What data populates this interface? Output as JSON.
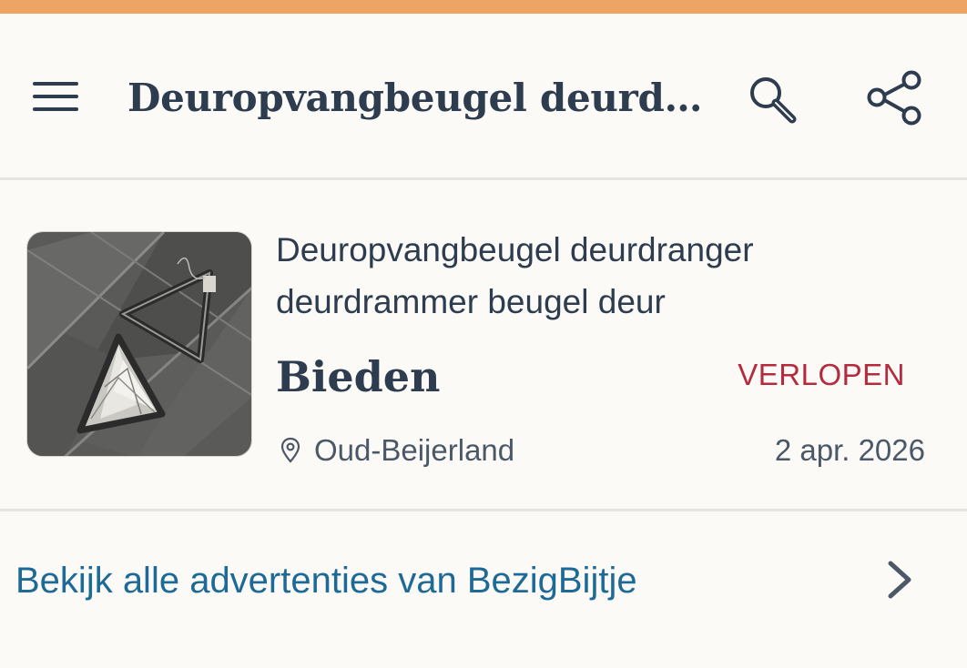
{
  "colors": {
    "accent_bar": "#eda464",
    "text_primary": "#2d3c4f",
    "status_expired": "#b52a3d",
    "link": "#1e6a97",
    "background": "#fcfaf6"
  },
  "header": {
    "menu_icon": "hamburger-menu-icon",
    "title": "Deuropvangbeugel deurdranger deurdrammer beugel deur",
    "search_icon": "search-icon",
    "share_icon": "share-icon"
  },
  "listing": {
    "title": "Deuropvangbeugel deurdranger deurdrammer beugel deur",
    "price": "Bieden",
    "status": "VERLOPEN",
    "location_icon": "location-pin-icon",
    "location": "Oud-Beijerland",
    "date": "2 apr. 2026"
  },
  "seller_link": {
    "label": "Bekijk alle advertenties van BezigBijtje",
    "icon": "chevron-right-icon"
  }
}
